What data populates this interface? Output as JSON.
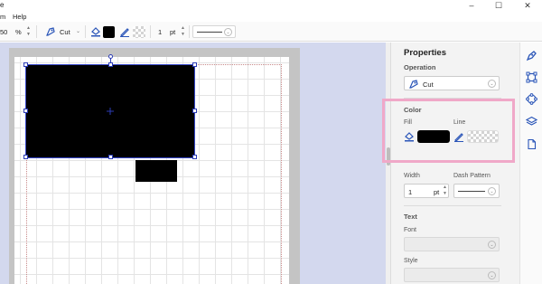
{
  "window": {
    "title_fragment": "e",
    "controls": {
      "minimize": "–",
      "maximize": "☐",
      "close": "✕"
    }
  },
  "menu": {
    "items": [
      "m",
      "Help"
    ]
  },
  "toolbar": {
    "zoom_value": "50",
    "zoom_unit": "%",
    "operation": "Cut",
    "fill_color": "#000000",
    "line_width_value": "1",
    "line_width_unit": "pt",
    "dash_pattern": "solid"
  },
  "canvas": {
    "background": "#d3d8ee",
    "shapes": [
      {
        "name": "rectangle-large",
        "fill": "#000000",
        "selected": true
      },
      {
        "name": "rectangle-small",
        "fill": "#000000",
        "selected": false
      }
    ]
  },
  "properties": {
    "title": "Properties",
    "operation": {
      "heading": "Operation",
      "value": "Cut"
    },
    "color": {
      "heading": "Color",
      "fill_label": "Fill",
      "fill_color": "#000000",
      "line_label": "Line",
      "line_color": "none"
    },
    "line": {
      "width_label": "Width",
      "width_value": "1",
      "width_unit": "pt",
      "dash_label": "Dash Pattern",
      "dash_value": "solid"
    },
    "text": {
      "heading": "Text",
      "font_label": "Font",
      "font_value": "",
      "style_label": "Style",
      "style_value": ""
    },
    "highlight_color": "#f0a8c8"
  },
  "rail": {
    "icons": [
      "pen-tool-icon",
      "transform-icon",
      "nodes-icon",
      "layers-icon",
      "document-icon"
    ],
    "accent": "#2a55b8"
  }
}
